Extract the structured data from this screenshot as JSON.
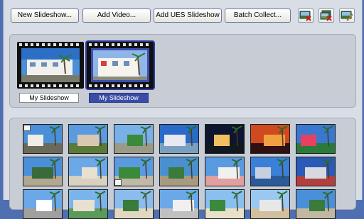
{
  "toolbar": {
    "buttons": [
      {
        "label": "New Slideshow..."
      },
      {
        "label": "Add Video..."
      },
      {
        "label": "Add UES Slideshow"
      },
      {
        "label": "Batch Collect..."
      }
    ],
    "icons": [
      "remove-image-icon",
      "remove-slideshow-icon",
      "edit-image-icon"
    ]
  },
  "slideshows": [
    {
      "label": "My Slideshow",
      "selected": false
    },
    {
      "label": "My Slideshow",
      "selected": true
    }
  ],
  "thumbnails": {
    "rows": 3,
    "columns": 7,
    "colors": {
      "sky": "#4a8fd8",
      "sunset": "#d04a20",
      "night": "#0d1530",
      "selection": "#3a4ca8"
    }
  }
}
